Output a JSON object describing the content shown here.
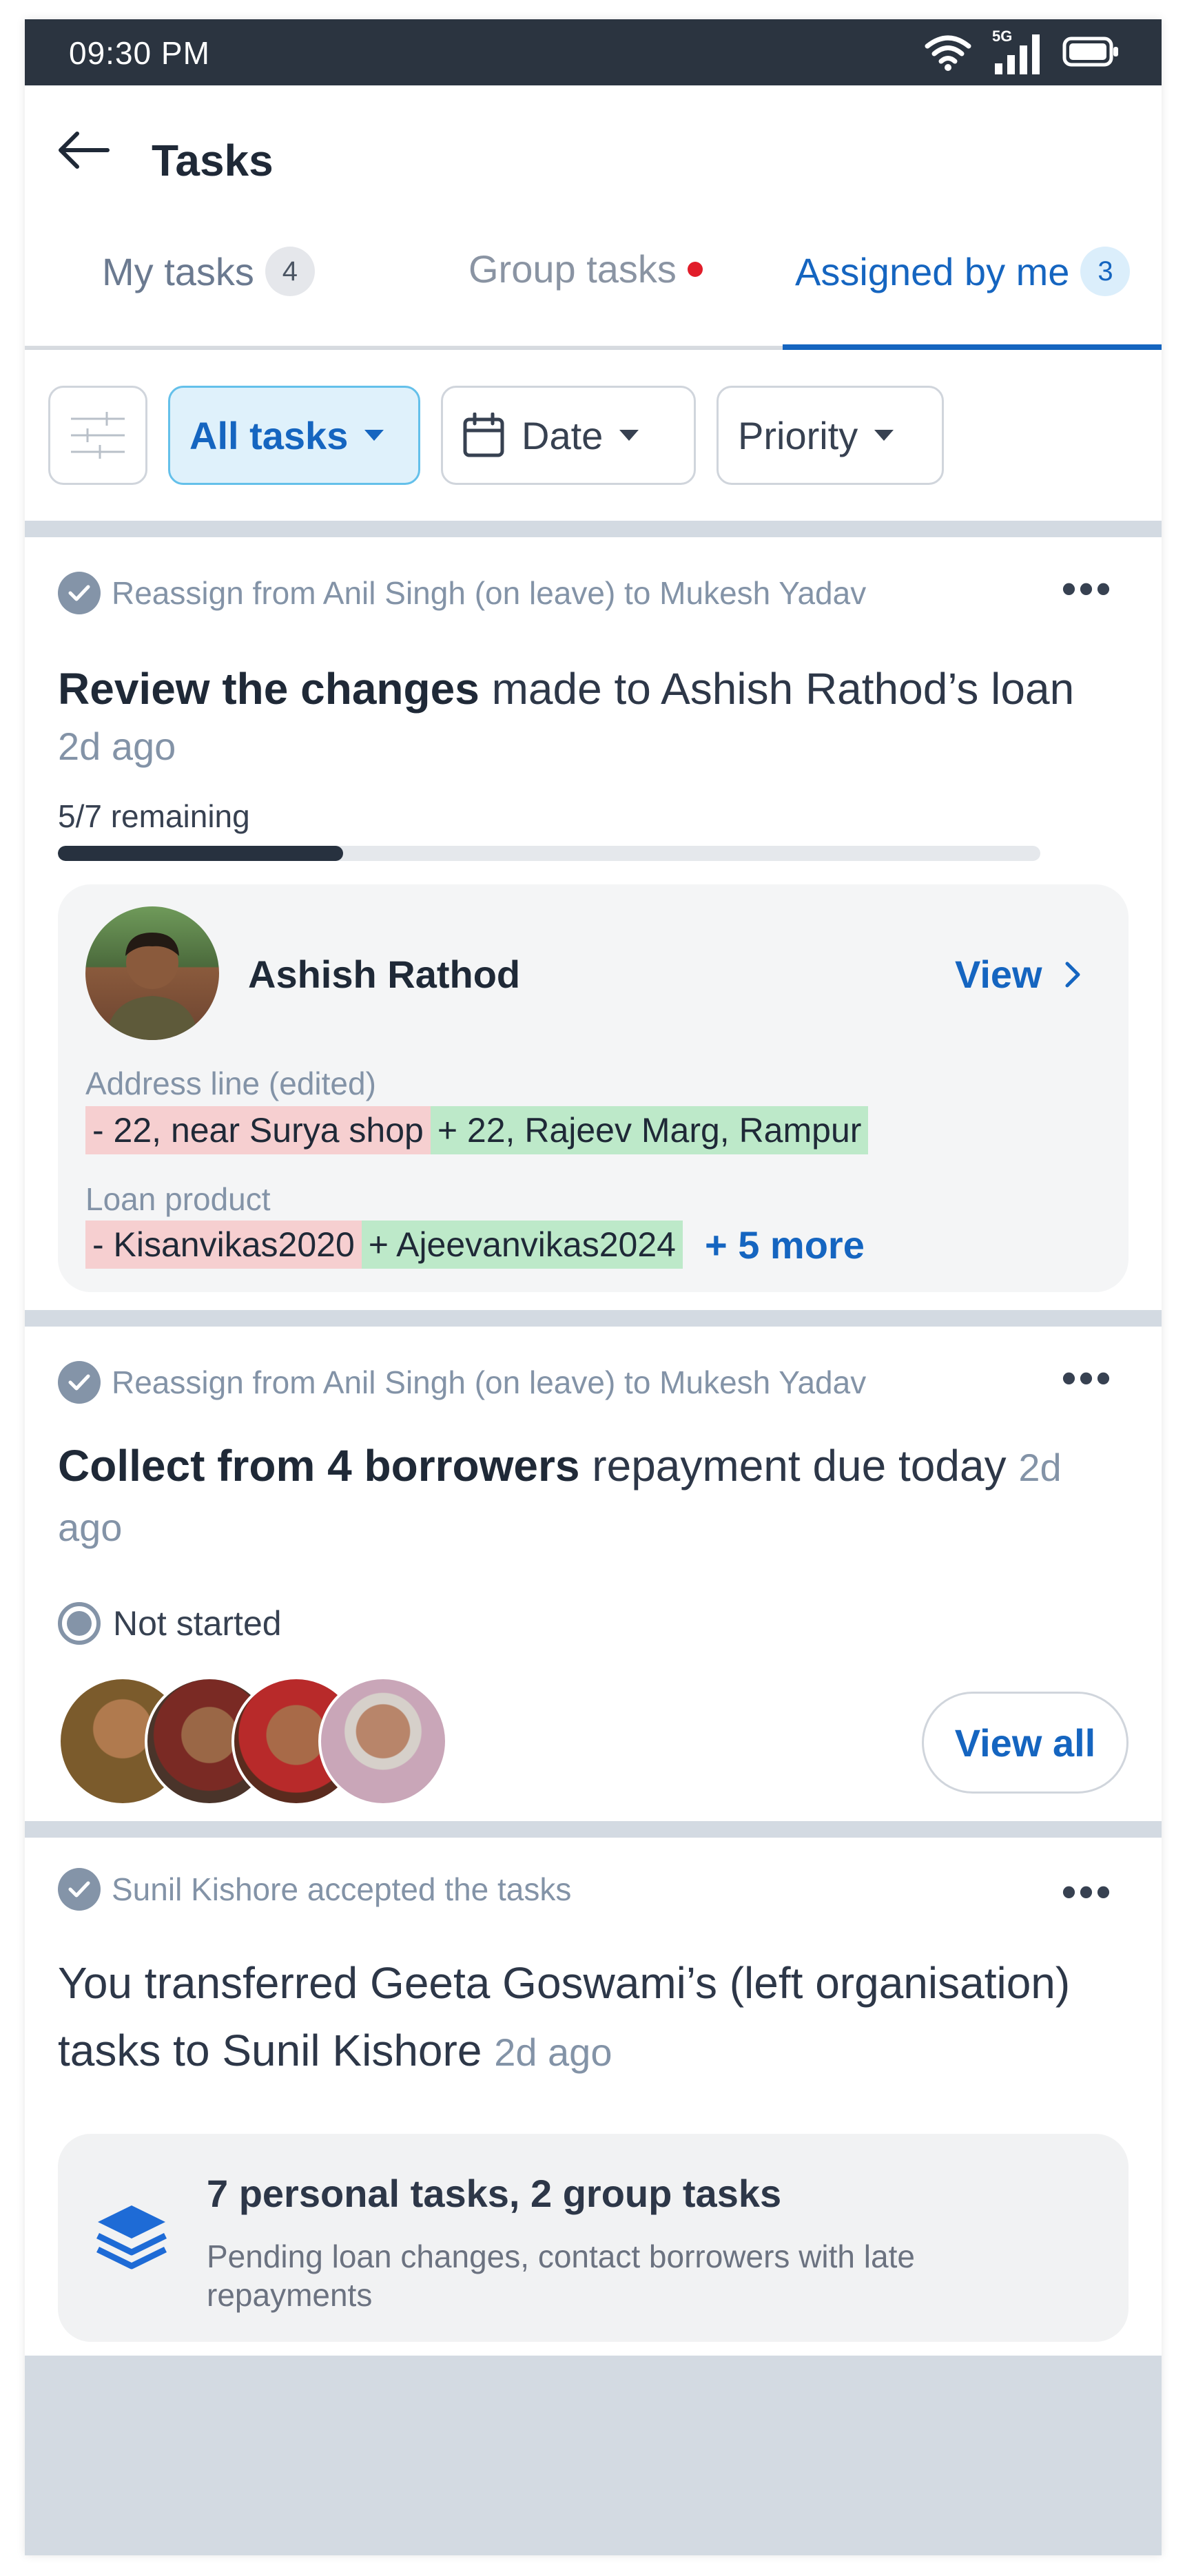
{
  "status_bar": {
    "time": "09:30 PM",
    "network": "5G"
  },
  "header": {
    "title": "Tasks"
  },
  "tabs": [
    {
      "label": "My tasks",
      "count": "4",
      "active": false
    },
    {
      "label": "Group tasks",
      "has_dot": true,
      "active": false
    },
    {
      "label": "Assigned by me",
      "count": "3",
      "active": true
    }
  ],
  "filters": {
    "all": "All tasks",
    "date": "Date",
    "priority": "Priority"
  },
  "cards": [
    {
      "meta": "Reassign from Anil Singh (on leave) to Mukesh Yadav",
      "title_bold": "Review the changes",
      "title_rest": " made to Ashish Rathod’s loan",
      "time": "2d ago",
      "progress_label": "5/7 remaining",
      "progress": 0.29,
      "person_name": "Ashish Rathod",
      "view_label": "View",
      "fields": [
        {
          "label": "Address line (edited)",
          "removed": "- 22, near Surya shop",
          "added": "+ 22, Rajeev Marg, Rampur"
        },
        {
          "label": "Loan product",
          "removed": "- Kisanvikas2020",
          "added": "+ Ajeevanvikas2024",
          "more": "+ 5 more"
        }
      ]
    },
    {
      "meta": "Reassign from Anil Singh (on leave) to Mukesh Yadav",
      "title_bold": "Collect from 4 borrowers",
      "title_rest": " repayment due today ",
      "time": "2d ago",
      "status": "Not started",
      "view_all": "View all"
    },
    {
      "meta": "Sunil Kishore accepted the tasks",
      "title": "You transferred Geeta Goswami’s (left organisation) tasks to Sunil Kishore ",
      "time": "2d ago",
      "summary_title": "7 personal tasks, 2 group tasks",
      "summary_desc": "Pending loan changes, contact borrowers with late repayments"
    }
  ],
  "colors": {
    "primary": "#1565c0",
    "status_bar": "#2b3440",
    "removed_bg": "#f6cfd0",
    "added_bg": "#bde9c9",
    "separator": "#d3dae2"
  }
}
